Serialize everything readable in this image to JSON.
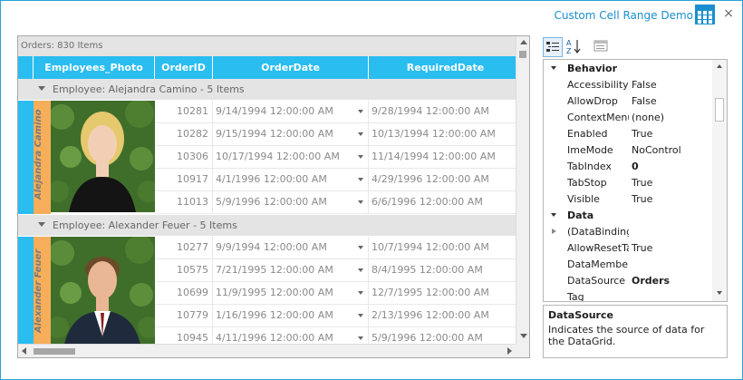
{
  "window": {
    "title": "Custom Cell Range Demo",
    "close_glyph": "×",
    "accent_color": "#29bdf0",
    "app_icon": "grid-sparkle-icon"
  },
  "grid": {
    "caption": "Orders: 830 Items",
    "columns": [
      "Employees_Photo",
      "OrderID",
      "OrderDate",
      "RequiredDate"
    ],
    "groups": [
      {
        "header": "Employee: Alejandra Camino - 5 Items",
        "employee_name": "Alejandra Camino",
        "rows": [
          {
            "order_id": "10281",
            "order_date": "9/14/1994 12:00:00 AM",
            "required_date": "9/28/1994 12:00:00 AM"
          },
          {
            "order_id": "10282",
            "order_date": "9/15/1994 12:00:00 AM",
            "required_date": "10/13/1994 12:00:00 AM"
          },
          {
            "order_id": "10306",
            "order_date": "10/17/1994 12:00:00 AM",
            "required_date": "11/14/1994 12:00:00 AM"
          },
          {
            "order_id": "10917",
            "order_date": "4/1/1996 12:00:00 AM",
            "required_date": "4/29/1996 12:00:00 AM"
          },
          {
            "order_id": "11013",
            "order_date": "5/9/1996 12:00:00 AM",
            "required_date": "6/6/1996 12:00:00 AM"
          }
        ]
      },
      {
        "header": "Employee: Alexander Feuer - 5 Items",
        "employee_name": "Alexander Feuer",
        "rows": [
          {
            "order_id": "10277",
            "order_date": "9/9/1994 12:00:00 AM",
            "required_date": "10/7/1994 12:00:00 AM"
          },
          {
            "order_id": "10575",
            "order_date": "7/21/1995 12:00:00 AM",
            "required_date": "8/4/1995 12:00:00 AM"
          },
          {
            "order_id": "10699",
            "order_date": "11/9/1995 12:00:00 AM",
            "required_date": "12/7/1995 12:00:00 AM"
          },
          {
            "order_id": "10779",
            "order_date": "1/16/1996 12:00:00 AM",
            "required_date": "2/13/1996 12:00:00 AM"
          },
          {
            "order_id": "10945",
            "order_date": "4/11/1996 12:00:00 AM",
            "required_date": "5/9/1996 12:00:00 AM"
          }
        ]
      }
    ]
  },
  "property_grid": {
    "toolbar": [
      "categorized-icon",
      "alphabetical-icon",
      "property-pages-icon"
    ],
    "items": [
      {
        "kind": "category",
        "name": "Behavior"
      },
      {
        "kind": "prop",
        "name": "AccessibilityEnabled",
        "value": "False",
        "bold": false
      },
      {
        "kind": "prop",
        "name": "AllowDrop",
        "value": "False",
        "bold": false
      },
      {
        "kind": "prop",
        "name": "ContextMenu",
        "value": "(none)",
        "bold": false
      },
      {
        "kind": "prop",
        "name": "Enabled",
        "value": "True",
        "bold": false
      },
      {
        "kind": "prop",
        "name": "ImeMode",
        "value": "NoControl",
        "bold": false
      },
      {
        "kind": "prop",
        "name": "TabIndex",
        "value": "0",
        "bold": true
      },
      {
        "kind": "prop",
        "name": "TabStop",
        "value": "True",
        "bold": false
      },
      {
        "kind": "prop",
        "name": "Visible",
        "value": "True",
        "bold": false
      },
      {
        "kind": "category",
        "name": "Data"
      },
      {
        "kind": "prop",
        "name": "(DataBindings)",
        "value": "",
        "bold": false,
        "expandable": true
      },
      {
        "kind": "prop",
        "name": "AllowResetTable",
        "value": "True",
        "bold": false
      },
      {
        "kind": "prop",
        "name": "DataMember",
        "value": "",
        "bold": false
      },
      {
        "kind": "prop",
        "name": "DataSource",
        "value": "Orders",
        "bold": true
      },
      {
        "kind": "prop",
        "name": "Tag",
        "value": "",
        "bold": false
      }
    ],
    "description_title": "DataSource",
    "description_text": "Indicates the source of data for the DataGrid."
  }
}
